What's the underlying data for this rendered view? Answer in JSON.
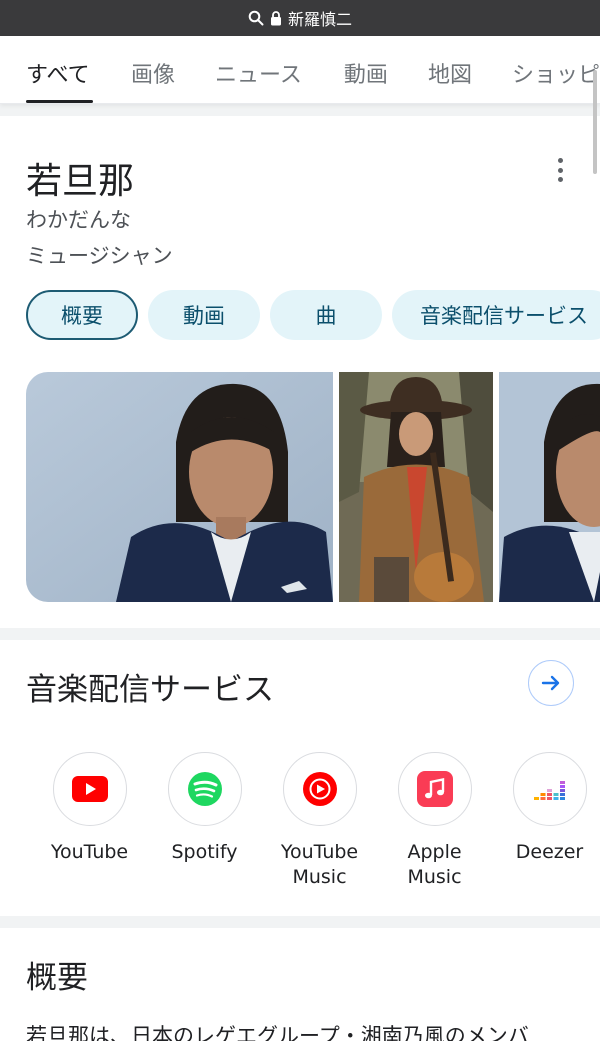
{
  "browser": {
    "url_text": "新羅慎二"
  },
  "tabs": [
    "すべて",
    "画像",
    "ニュース",
    "動画",
    "地図",
    "ショッピ"
  ],
  "knowledge_panel": {
    "title": "若旦那",
    "reading": "わかだんな",
    "type": "ミュージシャン",
    "chips": [
      "概要",
      "動画",
      "曲",
      "音楽配信サービス"
    ]
  },
  "music_services": {
    "title": "音楽配信サービス",
    "items": [
      {
        "label": "YouTube",
        "icon": "youtube-icon",
        "color": "#ff0000"
      },
      {
        "label": "Spotify",
        "icon": "spotify-icon",
        "color": "#1ed760"
      },
      {
        "label": "YouTube Music",
        "icon": "youtube-music-icon",
        "color": "#ff0000"
      },
      {
        "label": "Apple Music",
        "icon": "apple-music-icon",
        "color": "#fa3c55"
      },
      {
        "label": "Deezer",
        "icon": "deezer-icon",
        "color": "#ef5466"
      }
    ]
  },
  "overview": {
    "title": "概要",
    "text": "若旦那は、日本のレゲエグループ・湘南乃風のメンバ"
  }
}
